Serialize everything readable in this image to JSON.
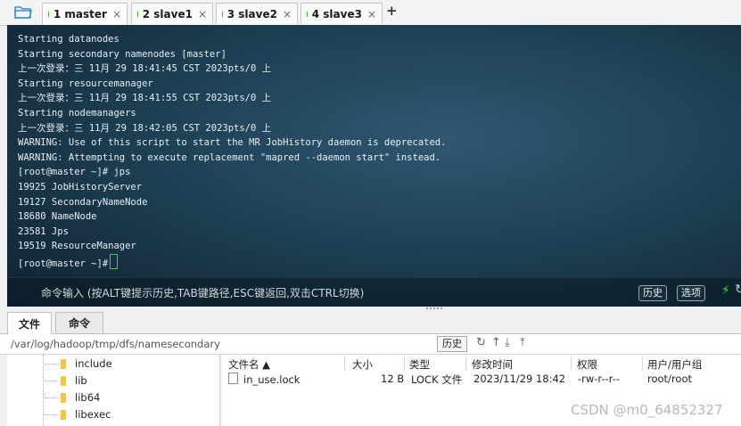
{
  "tabs": [
    {
      "label": "1 master",
      "active": true
    },
    {
      "label": "2 slave1",
      "active": false
    },
    {
      "label": "3 slave2",
      "active": false
    },
    {
      "label": "4 slave3",
      "active": false
    }
  ],
  "tab_close_glyph": "×",
  "tab_add_glyph": "+",
  "terminal": {
    "lines": [
      "Starting datanodes",
      "Starting secondary namenodes [master]",
      "上一次登录：三 11月 29 18:41:45 CST 2023pts/0 上",
      "Starting resourcemanager",
      "上一次登录：三 11月 29 18:41:55 CST 2023pts/0 上",
      "Starting nodemanagers",
      "上一次登录：三 11月 29 18:42:05 CST 2023pts/0 上",
      "WARNING: Use of this script to start the MR JobHistory daemon is deprecated.",
      "WARNING: Attempting to execute replacement \"mapred --daemon start\" instead.",
      "[root@master ~]# jps",
      "19925 JobHistoryServer",
      "19127 SecondaryNameNode",
      "18680 NameNode",
      "23581 Jps",
      "19519 ResourceManager"
    ],
    "prompt": "[root@master ~]#",
    "command_placeholder": "命令输入 (按ALT键提示历史,TAB键路径,ESC键返回,双击CTRL切换)",
    "history_button": "历史",
    "options_button": "选项"
  },
  "file_tabs": [
    {
      "label": "文件",
      "active": true
    },
    {
      "label": "命令",
      "active": false
    }
  ],
  "path_bar": {
    "path": "/var/log/hadoop/tmp/dfs/namesecondary",
    "history_button": "历史"
  },
  "tree_items": [
    "include",
    "lib",
    "lib64",
    "libexec"
  ],
  "file_list": {
    "columns": [
      "文件名 ▲",
      "大小",
      "类型",
      "修改时间",
      "权限",
      "用户/用户组"
    ],
    "rows": [
      {
        "name": "in_use.lock",
        "size": "12 B",
        "type": "LOCK 文件",
        "mtime": "2023/11/29 18:42",
        "perm": "-rw-r--r--",
        "owner": "root/root"
      }
    ]
  },
  "watermark": "CSDN @m0_64852327",
  "colors": {
    "active_dot": "#2bb32b",
    "cursor": "#2adf2a",
    "folder": "#f3c542"
  }
}
